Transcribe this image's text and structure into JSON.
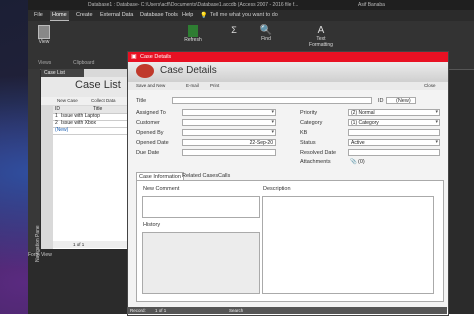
{
  "window": {
    "title": "Database1 : Database- C:\\Users\\acfl\\Documents\\Database1.accdb (Access 2007 - 2016 file f...",
    "user": "Asif Banaba"
  },
  "ribbon": {
    "tabs": [
      "File",
      "Home",
      "Create",
      "External Data",
      "Database Tools",
      "Help"
    ],
    "active_tab": "Home",
    "tell_me": "Tell me what you want to do",
    "view_label": "View",
    "views_group": "Views",
    "clipboard_group": "Clipboard",
    "refresh_label": "Refresh",
    "find_label": "Find",
    "text_label": "Text",
    "formatting_label": "Formatting"
  },
  "nav_pane": {
    "label": "Navigation Pane"
  },
  "status_left": "Form View",
  "case_list": {
    "tab_label": "Case List",
    "title": "Case List",
    "toolbar": [
      "New Case",
      "Collect Data"
    ],
    "col_id": "ID",
    "col_title": "Title",
    "rows": [
      {
        "id": "1",
        "title": "Issue with Laptop"
      },
      {
        "id": "2",
        "title": "Issue with Xbox"
      }
    ],
    "new_row": "(New)",
    "record_nav": "1 of 1"
  },
  "dialog": {
    "window_title": "Case Details",
    "title": "Case Details",
    "toolbar": [
      "Save and New",
      "E-mail",
      "Print"
    ],
    "close_label": "Close",
    "fields": {
      "title_label": "Title",
      "id_label": "ID",
      "id_value": "(New)",
      "assigned_to": "Assigned To",
      "customer": "Customer",
      "opened_by": "Opened By",
      "opened_date": "Opened Date",
      "opened_date_value": "22-Sep-20",
      "due_date": "Due Date",
      "priority": "Priority",
      "priority_value": "(2) Normal",
      "category": "Category",
      "category_value": "(1) Category",
      "kb": "KB",
      "status": "Status",
      "status_value": "Active",
      "resolved_date": "Resolved Date",
      "attachments": "Attachments",
      "attachments_value": "(0)"
    },
    "subtabs": [
      "Case Information",
      "Related Cases",
      "Calls"
    ],
    "new_comment": "New Comment",
    "history": "History",
    "description": "Description",
    "status_bar": {
      "record_label": "Record:",
      "record_value": "1 of 1",
      "search": "Search"
    }
  },
  "colors": {
    "close_bar": "#e81123",
    "ribbon_bg": "#333333"
  }
}
